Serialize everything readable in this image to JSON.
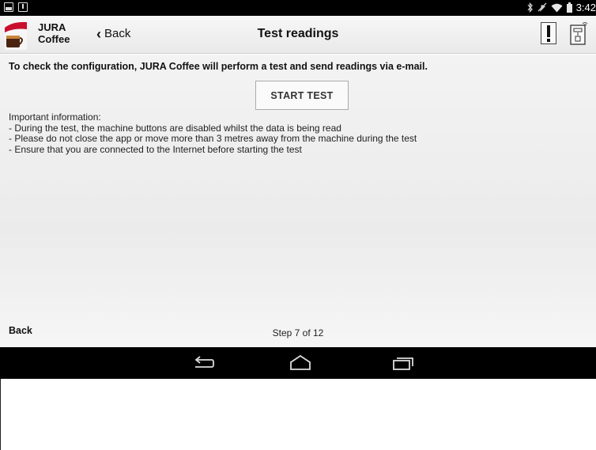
{
  "status_bar": {
    "time": "3:42",
    "left_icons": [
      "image-icon",
      "download-icon"
    ],
    "right_icons": [
      "bluetooth-icon",
      "mute-icon",
      "wifi-icon",
      "battery-icon"
    ]
  },
  "header": {
    "app_name": "JURA Coffee",
    "logo_text": "jura",
    "back_label": "Back",
    "title": "Test readings",
    "alert_icon": "exclamation-icon",
    "machine_icon": "coffee-machine-icon"
  },
  "main": {
    "intro": "To check the configuration, JURA Coffee will perform a test and send readings via e-mail.",
    "start_button": "START TEST",
    "info_heading": "Important information:",
    "info_lines": [
      "- During the test, the machine buttons are disabled whilst the data is being read",
      "- Please do not close the app or move more than 3 metres away from the machine during the test",
      "- Ensure that you are connected to the Internet before starting the test"
    ]
  },
  "footer": {
    "back_label": "Back",
    "step": "Step 7 of 12"
  },
  "nav_bar": {
    "icons": [
      "back-icon",
      "home-icon",
      "recent-apps-icon"
    ]
  },
  "colors": {
    "status_bar": "#000000",
    "header_bg": "#efefef",
    "content_bg": "#efefef",
    "logo_red": "#c8102e"
  }
}
